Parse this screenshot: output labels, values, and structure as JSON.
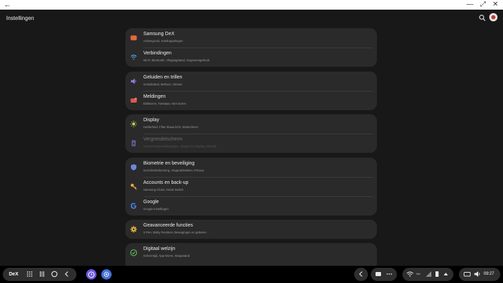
{
  "window": {
    "back": "←",
    "minimize": "—",
    "maximize": "⤢",
    "close": "✕"
  },
  "app": {
    "title": "Instellingen",
    "search_icon": "search-icon",
    "avatar_icon": "avatar"
  },
  "settings": [
    {
      "title": "Samsung DeX",
      "subtitle": "Achtergrond, Snelkoppelingen",
      "icon": "dex-icon",
      "color": "#e8663d"
    },
    {
      "title": "Verbindingen",
      "subtitle": "Wi-Fi, Bluetooth, Vliegtuigstand, Gegevensgebruik",
      "icon": "wifi-icon",
      "color": "#4fa3e6"
    },
    {
      "title": "Geluiden en trillen",
      "subtitle": "Geluidstand, Beltoon, Volume",
      "icon": "sound-icon",
      "color": "#9b7ae6"
    },
    {
      "title": "Meldingen",
      "subtitle": "Blokkeren, Toestaan, Niet storen",
      "icon": "notification-icon",
      "color": "#e0564f"
    },
    {
      "title": "Display",
      "subtitle": "Helderheid, Filter blauw licht, Startscherm",
      "icon": "brightness-icon",
      "color": "#c3d146"
    },
    {
      "title": "Vergrendelscherm",
      "subtitle": "Schermvergrendelingstype, Always On Display, Klokstijl",
      "icon": "lockscreen-icon",
      "color": "#5a5a8a"
    },
    {
      "title": "Biometrie en beveiliging",
      "subtitle": "Gezichtsherkenning, Vingerafdrukken, Privacy",
      "icon": "shield-icon",
      "color": "#6e86e0"
    },
    {
      "title": "Accounts en back-up",
      "subtitle": "Samsung Cloud, Smart Switch",
      "icon": "key-icon",
      "color": "#e8a23d"
    },
    {
      "title": "Google",
      "subtitle": "Google-instellingen",
      "icon": "google-icon",
      "color": "#4a7fe8"
    },
    {
      "title": "Geavanceerde functies",
      "subtitle": "S Pen, Bixby Routines, Bewegingen en gebaren",
      "icon": "gear-icon",
      "color": "#e8b23d"
    },
    {
      "title": "Digitaal welzijn",
      "subtitle": "Schermtijd, App-timers, Slaapstand",
      "icon": "wellbeing-icon",
      "color": "#5fb85a"
    }
  ],
  "taskbar": {
    "dex_label": "DeX",
    "time": "09:27",
    "status_text": "Vol",
    "apps": [
      {
        "name": "clock-app-icon",
        "color": "#6b5be0"
      },
      {
        "name": "settings-app-icon",
        "color": "#3f6fd8"
      }
    ]
  }
}
